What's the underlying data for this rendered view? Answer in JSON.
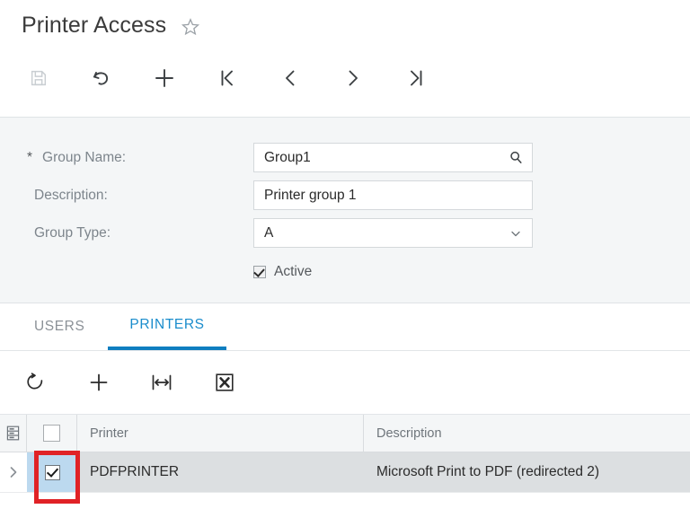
{
  "header": {
    "title": "Printer Access",
    "favorite_icon": "star-outline-icon"
  },
  "main_toolbar": {
    "buttons": [
      {
        "name": "save-button",
        "icon": "save-icon",
        "label": "Save",
        "disabled": true
      },
      {
        "name": "undo-button",
        "icon": "undo-icon",
        "label": "Undo",
        "disabled": false
      },
      {
        "name": "add-button",
        "icon": "plus-icon",
        "label": "Add",
        "disabled": false
      },
      {
        "name": "first-record-button",
        "icon": "first-page-icon",
        "label": "First",
        "disabled": false
      },
      {
        "name": "previous-record-button",
        "icon": "chevron-left-icon",
        "label": "Previous",
        "disabled": false
      },
      {
        "name": "next-record-button",
        "icon": "chevron-right-icon",
        "label": "Next",
        "disabled": false
      },
      {
        "name": "last-record-button",
        "icon": "last-page-icon",
        "label": "Last",
        "disabled": false
      }
    ]
  },
  "form": {
    "group_name": {
      "label": "Group Name:",
      "required_marker": "*",
      "value": "Group1",
      "icon": "magnifier-icon"
    },
    "description": {
      "label": "Description:",
      "value": "Printer group 1"
    },
    "group_type": {
      "label": "Group Type:",
      "value": "A",
      "icon": "chevron-down-icon"
    },
    "active": {
      "label": "Active",
      "checked": true
    }
  },
  "tabs": [
    {
      "label": "USERS",
      "active": false
    },
    {
      "label": "PRINTERS",
      "active": true
    }
  ],
  "grid_toolbar": {
    "buttons": [
      {
        "name": "refresh-button",
        "icon": "refresh-icon",
        "label": "Refresh"
      },
      {
        "name": "add-row-button",
        "icon": "plus-icon",
        "label": "Add Row"
      },
      {
        "name": "fit-columns-button",
        "icon": "fit-columns-icon",
        "label": "Fit to Screen"
      },
      {
        "name": "export-excel-button",
        "icon": "excel-export-icon",
        "label": "Export to Excel"
      }
    ]
  },
  "grid": {
    "header": {
      "settings_icon": "column-settings-icon",
      "select_all_checked": false,
      "columns": [
        "Printer",
        "Description"
      ]
    },
    "rows": [
      {
        "expand_icon": "chevron-right-icon",
        "selected": true,
        "checked": true,
        "printer": "PDFPRINTER",
        "description": "Microsoft Print to PDF (redirected 2)"
      }
    ]
  },
  "annotation": {
    "type": "highlight-box",
    "color": "#e02226",
    "target": "printer-row-checkbox"
  },
  "colors": {
    "accent_blue": "#0f7ec0",
    "tab_text_blue": "#1a8ccc",
    "panel_bg": "#f4f6f7",
    "row_selected_bg": "#dcdfe1",
    "checkbox_cell_bg": "#bcd9ef",
    "annotation_red": "#e02226"
  }
}
